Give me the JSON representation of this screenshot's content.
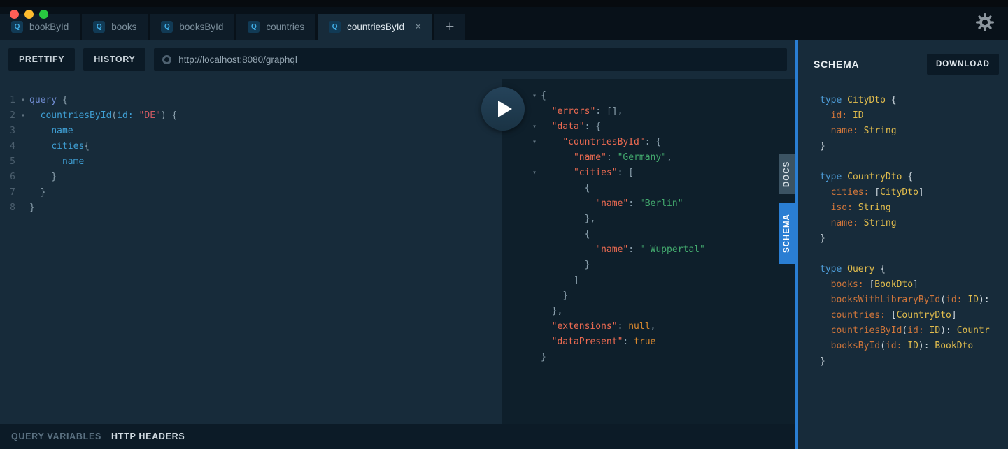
{
  "colors": {
    "accent_blue": "#2a7ed3",
    "traffic_red": "#ff5f57",
    "traffic_yellow": "#febc2e",
    "traffic_green": "#28c840"
  },
  "icons": {
    "fold": "▾"
  },
  "tabs": {
    "icon_letter": "Q",
    "close_label": "×",
    "new_tab_label": "+",
    "items": [
      {
        "label": "bookById",
        "active": false
      },
      {
        "label": "books",
        "active": false
      },
      {
        "label": "booksById",
        "active": false
      },
      {
        "label": "countries",
        "active": false
      },
      {
        "label": "countriesById",
        "active": true
      }
    ]
  },
  "toolbar": {
    "prettify_label": "PRETTIFY",
    "history_label": "HISTORY",
    "url_value": "http://localhost:8080/graphql"
  },
  "editor": {
    "lines": [
      {
        "num": "1",
        "fold": true,
        "tokens": [
          [
            "query ",
            "kw"
          ],
          [
            "{",
            "pun"
          ]
        ]
      },
      {
        "num": "2",
        "fold": true,
        "tokens": [
          [
            "  ",
            "pl"
          ],
          [
            "countriesById",
            "fld"
          ],
          [
            "(",
            "pun"
          ],
          [
            "id:",
            "fld"
          ],
          [
            " ",
            "pl"
          ],
          [
            "\"DE\"",
            "strr"
          ],
          [
            ")",
            "pun"
          ],
          [
            " ",
            "pl"
          ],
          [
            "{",
            "pun"
          ]
        ]
      },
      {
        "num": "3",
        "fold": false,
        "tokens": [
          [
            "    ",
            "pl"
          ],
          [
            "name",
            "fld"
          ]
        ]
      },
      {
        "num": "4",
        "fold": false,
        "tokens": [
          [
            "    ",
            "pl"
          ],
          [
            "cities",
            "fld"
          ],
          [
            "{",
            "pun"
          ]
        ]
      },
      {
        "num": "5",
        "fold": false,
        "tokens": [
          [
            "      ",
            "pl"
          ],
          [
            "name",
            "fld"
          ]
        ]
      },
      {
        "num": "6",
        "fold": false,
        "tokens": [
          [
            "    ",
            "pl"
          ],
          [
            "}",
            "pun"
          ]
        ]
      },
      {
        "num": "7",
        "fold": false,
        "tokens": [
          [
            "  ",
            "pl"
          ],
          [
            "}",
            "pun"
          ]
        ]
      },
      {
        "num": "8",
        "fold": false,
        "tokens": [
          [
            "}",
            "pun"
          ]
        ]
      }
    ]
  },
  "response": {
    "lines": [
      {
        "fold": true,
        "tokens": [
          [
            "{",
            "pun"
          ]
        ]
      },
      {
        "fold": false,
        "tokens": [
          [
            "  ",
            "pl"
          ],
          [
            "\"errors\"",
            "key"
          ],
          [
            ": ",
            "pun"
          ],
          [
            "[],",
            "pun"
          ]
        ]
      },
      {
        "fold": true,
        "tokens": [
          [
            "  ",
            "pl"
          ],
          [
            "\"data\"",
            "key"
          ],
          [
            ": ",
            "pun"
          ],
          [
            "{",
            "pun"
          ]
        ]
      },
      {
        "fold": true,
        "tokens": [
          [
            "    ",
            "pl"
          ],
          [
            "\"countriesById\"",
            "key"
          ],
          [
            ": ",
            "pun"
          ],
          [
            "{",
            "pun"
          ]
        ]
      },
      {
        "fold": false,
        "tokens": [
          [
            "      ",
            "pl"
          ],
          [
            "\"name\"",
            "key"
          ],
          [
            ": ",
            "pun"
          ],
          [
            "\"Germany\"",
            "str"
          ],
          [
            ",",
            "pun"
          ]
        ]
      },
      {
        "fold": true,
        "tokens": [
          [
            "      ",
            "pl"
          ],
          [
            "\"cities\"",
            "key"
          ],
          [
            ": ",
            "pun"
          ],
          [
            "[",
            "pun"
          ]
        ]
      },
      {
        "fold": false,
        "tokens": [
          [
            "        ",
            "pl"
          ],
          [
            "{",
            "pun"
          ]
        ]
      },
      {
        "fold": false,
        "tokens": [
          [
            "          ",
            "pl"
          ],
          [
            "\"name\"",
            "key"
          ],
          [
            ": ",
            "pun"
          ],
          [
            "\"Berlin\"",
            "str"
          ]
        ]
      },
      {
        "fold": false,
        "tokens": [
          [
            "        ",
            "pl"
          ],
          [
            "},",
            "pun"
          ]
        ]
      },
      {
        "fold": false,
        "tokens": [
          [
            "        ",
            "pl"
          ],
          [
            "{",
            "pun"
          ]
        ]
      },
      {
        "fold": false,
        "tokens": [
          [
            "          ",
            "pl"
          ],
          [
            "\"name\"",
            "key"
          ],
          [
            ": ",
            "pun"
          ],
          [
            "\" Wuppertal\"",
            "str"
          ]
        ]
      },
      {
        "fold": false,
        "tokens": [
          [
            "        ",
            "pl"
          ],
          [
            "}",
            "pun"
          ]
        ]
      },
      {
        "fold": false,
        "tokens": [
          [
            "      ",
            "pl"
          ],
          [
            "]",
            "pun"
          ]
        ]
      },
      {
        "fold": false,
        "tokens": [
          [
            "    ",
            "pl"
          ],
          [
            "}",
            "pun"
          ]
        ]
      },
      {
        "fold": false,
        "tokens": [
          [
            "  ",
            "pl"
          ],
          [
            "},",
            "pun"
          ]
        ]
      },
      {
        "fold": false,
        "tokens": [
          [
            "  ",
            "pl"
          ],
          [
            "\"extensions\"",
            "key"
          ],
          [
            ": ",
            "pun"
          ],
          [
            "null",
            "atom"
          ],
          [
            ",",
            "pun"
          ]
        ]
      },
      {
        "fold": false,
        "tokens": [
          [
            "  ",
            "pl"
          ],
          [
            "\"dataPresent\"",
            "key"
          ],
          [
            ": ",
            "pun"
          ],
          [
            "true",
            "atom"
          ]
        ]
      },
      {
        "fold": false,
        "tokens": [
          [
            "}",
            "pun"
          ]
        ]
      }
    ]
  },
  "side_tabs": {
    "docs": "DOCS",
    "schema": "SCHEMA"
  },
  "sidebar": {
    "title": "SCHEMA",
    "download_label": "DOWNLOAD",
    "lines": [
      {
        "tokens": [
          [
            "type ",
            "skw"
          ],
          [
            "CityDto",
            "tname"
          ],
          [
            " {",
            "wpun"
          ]
        ]
      },
      {
        "tokens": [
          [
            "  ",
            "pl"
          ],
          [
            "id:",
            "fname"
          ],
          [
            " ",
            "pl"
          ],
          [
            "ID",
            "tname"
          ]
        ]
      },
      {
        "tokens": [
          [
            "  ",
            "pl"
          ],
          [
            "name:",
            "fname"
          ],
          [
            " ",
            "pl"
          ],
          [
            "String",
            "tname"
          ]
        ]
      },
      {
        "tokens": [
          [
            "}",
            "wpun"
          ]
        ]
      },
      {
        "tokens": []
      },
      {
        "tokens": [
          [
            "type ",
            "skw"
          ],
          [
            "CountryDto",
            "tname"
          ],
          [
            " {",
            "wpun"
          ]
        ]
      },
      {
        "tokens": [
          [
            "  ",
            "pl"
          ],
          [
            "cities:",
            "fname"
          ],
          [
            " ",
            "pl"
          ],
          [
            "[",
            "wpun"
          ],
          [
            "CityDto",
            "tname"
          ],
          [
            "]",
            "wpun"
          ]
        ]
      },
      {
        "tokens": [
          [
            "  ",
            "pl"
          ],
          [
            "iso:",
            "fname"
          ],
          [
            " ",
            "pl"
          ],
          [
            "String",
            "tname"
          ]
        ]
      },
      {
        "tokens": [
          [
            "  ",
            "pl"
          ],
          [
            "name:",
            "fname"
          ],
          [
            " ",
            "pl"
          ],
          [
            "String",
            "tname"
          ]
        ]
      },
      {
        "tokens": [
          [
            "}",
            "wpun"
          ]
        ]
      },
      {
        "tokens": []
      },
      {
        "tokens": [
          [
            "type ",
            "skw"
          ],
          [
            "Query",
            "tname"
          ],
          [
            " {",
            "wpun"
          ]
        ]
      },
      {
        "tokens": [
          [
            "  ",
            "pl"
          ],
          [
            "books:",
            "fname"
          ],
          [
            " ",
            "pl"
          ],
          [
            "[",
            "wpun"
          ],
          [
            "BookDto",
            "tname"
          ],
          [
            "]",
            "wpun"
          ]
        ]
      },
      {
        "tokens": [
          [
            "  ",
            "pl"
          ],
          [
            "booksWithLibraryById",
            "fname"
          ],
          [
            "(",
            "wpun"
          ],
          [
            "id:",
            "fname"
          ],
          [
            " ",
            "pl"
          ],
          [
            "ID",
            "tname"
          ],
          [
            "):",
            "wpun"
          ]
        ]
      },
      {
        "tokens": [
          [
            "  ",
            "pl"
          ],
          [
            "countries:",
            "fname"
          ],
          [
            " ",
            "pl"
          ],
          [
            "[",
            "wpun"
          ],
          [
            "CountryDto",
            "tname"
          ],
          [
            "]",
            "wpun"
          ]
        ]
      },
      {
        "tokens": [
          [
            "  ",
            "pl"
          ],
          [
            "countriesById",
            "fname"
          ],
          [
            "(",
            "wpun"
          ],
          [
            "id:",
            "fname"
          ],
          [
            " ",
            "pl"
          ],
          [
            "ID",
            "tname"
          ],
          [
            "): ",
            "wpun"
          ],
          [
            "Countr",
            "tname"
          ]
        ]
      },
      {
        "tokens": [
          [
            "  ",
            "pl"
          ],
          [
            "booksById",
            "fname"
          ],
          [
            "(",
            "wpun"
          ],
          [
            "id:",
            "fname"
          ],
          [
            " ",
            "pl"
          ],
          [
            "ID",
            "tname"
          ],
          [
            "): ",
            "wpun"
          ],
          [
            "BookDto",
            "tname"
          ]
        ]
      },
      {
        "tokens": [
          [
            "}",
            "wpun"
          ]
        ]
      }
    ]
  },
  "bottom_bar": {
    "query_variables": "QUERY VARIABLES",
    "http_headers": "HTTP HEADERS"
  }
}
